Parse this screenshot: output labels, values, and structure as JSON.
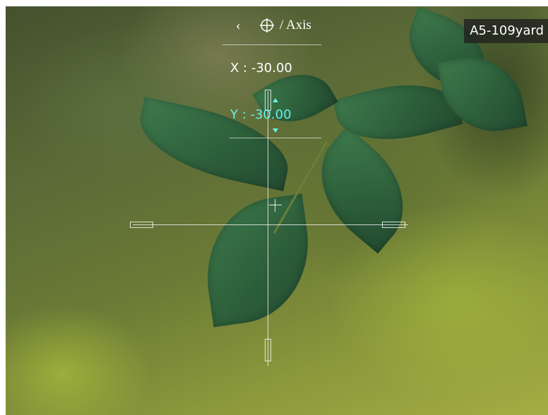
{
  "nav": {
    "back_icon": "chevron-left-icon",
    "target_icon": "crosshair-target-icon",
    "title": "/ Axis"
  },
  "profile": {
    "label": "A5-109yard"
  },
  "coordinates": {
    "x_label": "X : -30.00",
    "y_label": "Y : -30.00"
  },
  "colors": {
    "active_accent": "#66f0e6",
    "text": "#ffffff",
    "badge_bg": "#1e1e1e"
  }
}
